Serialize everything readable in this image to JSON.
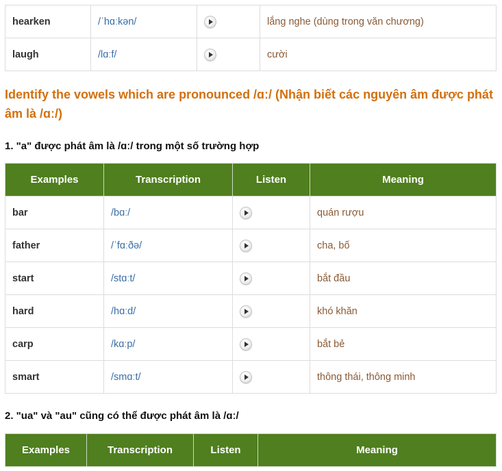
{
  "top_table": {
    "rows": [
      {
        "word": "hearken",
        "transcription": "/ˈhɑːkən/",
        "meaning": "lắng nghe (dùng trong văn chương)"
      },
      {
        "word": "laugh",
        "transcription": "/lɑːf/",
        "meaning": "cười"
      }
    ]
  },
  "heading": "Identify the vowels which are pronounced /ɑː/ (Nhận biết các nguyên âm được phát âm là /ɑː/)",
  "section1": {
    "title": "1. \"a\" được phát âm là /ɑː/ trong một số trường hợp",
    "headers": [
      "Examples",
      "Transcription",
      "Listen",
      "Meaning"
    ],
    "rows": [
      {
        "word": "bar",
        "transcription": "/bɑː/",
        "meaning": "quán rượu"
      },
      {
        "word": "father",
        "transcription": "/ˈfɑːðə/",
        "meaning": "cha, bố"
      },
      {
        "word": "start",
        "transcription": "/stɑːt/",
        "meaning": "bắt đầu"
      },
      {
        "word": "hard",
        "transcription": "/hɑːd/",
        "meaning": "khó khăn"
      },
      {
        "word": "carp",
        "transcription": "/kɑːp/",
        "meaning": "bắt bẻ"
      },
      {
        "word": "smart",
        "transcription": "/smɑːt/",
        "meaning": "thông thái, thông minh"
      }
    ]
  },
  "section2": {
    "title": "2. \"ua\" và \"au\" cũng có thể được phát âm là /ɑː/",
    "headers": [
      "Examples",
      "Transcription",
      "Listen",
      "Meaning"
    ]
  },
  "colors": {
    "header_green": "#4f7f1e",
    "heading_orange": "#d2700f",
    "transcription_blue": "#3a6ea5",
    "meaning_brown": "#8a5a35"
  },
  "icons": {
    "listen": "play-audio-icon"
  }
}
